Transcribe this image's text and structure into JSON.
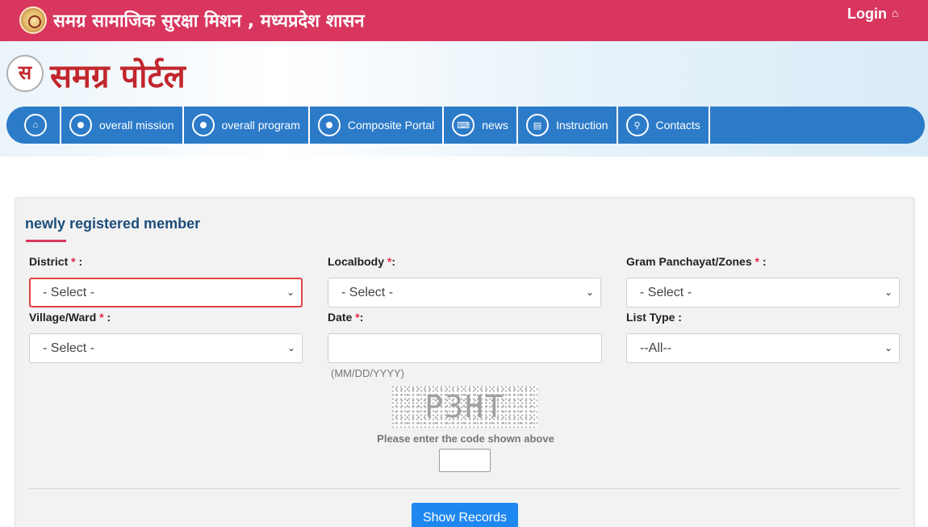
{
  "topbar": {
    "title": "समग्र सामाजिक सुरक्षा मिशन , मध्यप्रदेश शासन",
    "login_label": "Login",
    "login_icon": "home-icon"
  },
  "header": {
    "logo_glyph": "स",
    "portal_title": "समग्र पोर्टल"
  },
  "nav": {
    "items": [
      {
        "label": "",
        "icon": "home-icon"
      },
      {
        "label": "overall mission",
        "icon": "globe-icon"
      },
      {
        "label": "overall program",
        "icon": "globe-icon"
      },
      {
        "label": "Composite Portal",
        "icon": "globe-icon"
      },
      {
        "label": "news",
        "icon": "keyboard-icon"
      },
      {
        "label": "Instruction",
        "icon": "list-icon"
      },
      {
        "label": "Contacts",
        "icon": "map-marker-icon"
      }
    ]
  },
  "form": {
    "title": "newly registered member",
    "district": {
      "label": "District",
      "suffix": " :",
      "value": "- Select -"
    },
    "localbody": {
      "label": "Localbody",
      "suffix": ":",
      "value": "- Select -"
    },
    "gram_panchayat": {
      "label": "Gram Panchayat/Zones",
      "suffix": " :",
      "value": "- Select -"
    },
    "village": {
      "label": "Village/Ward",
      "suffix": " :",
      "value": "- Select -"
    },
    "date": {
      "label": "Date",
      "suffix": ":",
      "value": "",
      "hint": "(MM/DD/YYYY)"
    },
    "list_type": {
      "label": "List Type :",
      "value": "--All--"
    },
    "required_mark": "*",
    "captcha_text": "P3HT",
    "captcha_label": "Please enter the code shown above",
    "captcha_value": "",
    "submit_label": "Show Records"
  },
  "colors": {
    "topbar": "#d8365e",
    "nav": "#2c7bc9",
    "button": "#1e87f0",
    "required": "#e0284f",
    "title": "#1d4d7a"
  }
}
